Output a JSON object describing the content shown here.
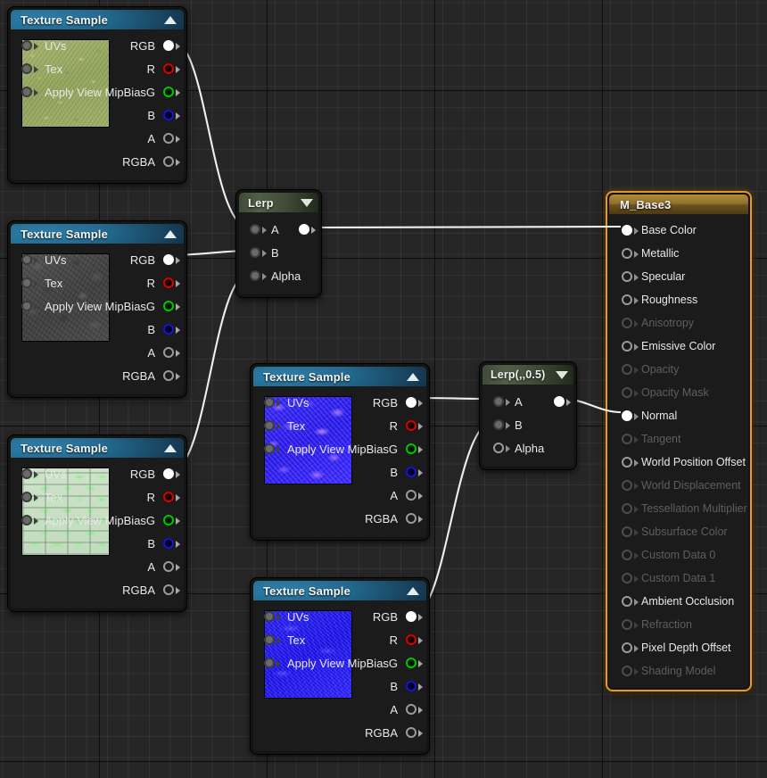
{
  "editor": {
    "name": "material-graph-editor",
    "background_color": "#262626",
    "grid_line_color": "#3a3a3a",
    "wire_color": "#ffffff"
  },
  "nodes": {
    "texture_grass": {
      "title": "Texture Sample",
      "header_color": "#23688f",
      "collapse_icon": "triangle-up-icon",
      "thumbnail": "grass-texture",
      "inputs": [
        {
          "label": "UVs",
          "connected": false
        },
        {
          "label": "Tex",
          "connected": false
        },
        {
          "label": "Apply View MipBias",
          "connected": false
        }
      ],
      "outputs": [
        {
          "label": "RGB",
          "type": "white",
          "connected": true
        },
        {
          "label": "R",
          "type": "red",
          "connected": false
        },
        {
          "label": "G",
          "type": "green",
          "connected": false
        },
        {
          "label": "B",
          "type": "blue",
          "connected": false
        },
        {
          "label": "A",
          "type": "grey",
          "connected": false
        },
        {
          "label": "RGBA",
          "type": "grey",
          "connected": false
        }
      ]
    },
    "texture_rock": {
      "title": "Texture Sample",
      "header_color": "#23688f",
      "collapse_icon": "triangle-up-icon",
      "thumbnail": "rock-texture",
      "inputs": [
        {
          "label": "UVs",
          "connected": false
        },
        {
          "label": "Tex",
          "connected": false
        },
        {
          "label": "Apply View MipBias",
          "connected": false
        }
      ],
      "outputs": [
        {
          "label": "RGB",
          "type": "white",
          "connected": true
        },
        {
          "label": "R",
          "type": "red",
          "connected": false
        },
        {
          "label": "G",
          "type": "green",
          "connected": false
        },
        {
          "label": "B",
          "type": "blue",
          "connected": false
        },
        {
          "label": "A",
          "type": "grey",
          "connected": false
        },
        {
          "label": "RGBA",
          "type": "grey",
          "connected": false
        }
      ]
    },
    "texture_mint": {
      "title": "Texture Sample",
      "header_color": "#23688f",
      "collapse_icon": "triangle-up-icon",
      "thumbnail": "mint-brick-texture",
      "inputs": [
        {
          "label": "UVs",
          "connected": false
        },
        {
          "label": "Tex",
          "connected": false
        },
        {
          "label": "Apply View MipBias",
          "connected": false
        }
      ],
      "outputs": [
        {
          "label": "RGB",
          "type": "white",
          "connected": true
        },
        {
          "label": "R",
          "type": "red",
          "connected": false
        },
        {
          "label": "G",
          "type": "green",
          "connected": false
        },
        {
          "label": "B",
          "type": "blue",
          "connected": false
        },
        {
          "label": "A",
          "type": "grey",
          "connected": false
        },
        {
          "label": "RGBA",
          "type": "grey",
          "connected": false
        }
      ]
    },
    "texture_normal_rough": {
      "title": "Texture Sample",
      "header_color": "#23688f",
      "collapse_icon": "triangle-up-icon",
      "thumbnail": "normal-map-rough-texture",
      "inputs": [
        {
          "label": "UVs",
          "connected": false
        },
        {
          "label": "Tex",
          "connected": false
        },
        {
          "label": "Apply View MipBias",
          "connected": false
        }
      ],
      "outputs": [
        {
          "label": "RGB",
          "type": "white",
          "connected": true
        },
        {
          "label": "R",
          "type": "red",
          "connected": false
        },
        {
          "label": "G",
          "type": "green",
          "connected": false
        },
        {
          "label": "B",
          "type": "blue",
          "connected": false
        },
        {
          "label": "A",
          "type": "grey",
          "connected": false
        },
        {
          "label": "RGBA",
          "type": "grey",
          "connected": false
        }
      ]
    },
    "texture_normal_flat": {
      "title": "Texture Sample",
      "header_color": "#23688f",
      "collapse_icon": "triangle-up-icon",
      "thumbnail": "normal-map-flat-texture",
      "inputs": [
        {
          "label": "UVs",
          "connected": false
        },
        {
          "label": "Tex",
          "connected": false
        },
        {
          "label": "Apply View MipBias",
          "connected": false
        }
      ],
      "outputs": [
        {
          "label": "RGB",
          "type": "white",
          "connected": true
        },
        {
          "label": "R",
          "type": "red",
          "connected": false
        },
        {
          "label": "G",
          "type": "green",
          "connected": false
        },
        {
          "label": "B",
          "type": "blue",
          "connected": false
        },
        {
          "label": "A",
          "type": "grey",
          "connected": false
        },
        {
          "label": "RGBA",
          "type": "grey",
          "connected": false
        }
      ]
    },
    "lerp_base": {
      "title": "Lerp",
      "header_color": "#4c5a42",
      "collapse_icon": "triangle-down-icon",
      "inputs": [
        {
          "label": "A",
          "connected": true
        },
        {
          "label": "B",
          "connected": true
        },
        {
          "label": "Alpha",
          "connected": true
        }
      ],
      "output": {
        "connected": true
      }
    },
    "lerp_normal": {
      "title": "Lerp(,,0.5)",
      "header_color": "#4c5a42",
      "collapse_icon": "triangle-down-icon",
      "inputs": [
        {
          "label": "A",
          "connected": true
        },
        {
          "label": "B",
          "connected": true
        },
        {
          "label": "Alpha",
          "connected": false
        }
      ],
      "output": {
        "connected": true
      }
    },
    "material_output": {
      "title": "M_Base3",
      "header_color": "#8e6f2b",
      "border_color": "#e79a1c",
      "selected": true,
      "pins": [
        {
          "label": "Base Color",
          "enabled": true,
          "connected": true
        },
        {
          "label": "Metallic",
          "enabled": true,
          "connected": false
        },
        {
          "label": "Specular",
          "enabled": true,
          "connected": false
        },
        {
          "label": "Roughness",
          "enabled": true,
          "connected": false
        },
        {
          "label": "Anisotropy",
          "enabled": false,
          "connected": false
        },
        {
          "label": "Emissive Color",
          "enabled": true,
          "connected": false
        },
        {
          "label": "Opacity",
          "enabled": false,
          "connected": false
        },
        {
          "label": "Opacity Mask",
          "enabled": false,
          "connected": false
        },
        {
          "label": "Normal",
          "enabled": true,
          "connected": true
        },
        {
          "label": "Tangent",
          "enabled": false,
          "connected": false
        },
        {
          "label": "World Position Offset",
          "enabled": true,
          "connected": false
        },
        {
          "label": "World Displacement",
          "enabled": false,
          "connected": false
        },
        {
          "label": "Tessellation Multiplier",
          "enabled": false,
          "connected": false
        },
        {
          "label": "Subsurface Color",
          "enabled": false,
          "connected": false
        },
        {
          "label": "Custom Data 0",
          "enabled": false,
          "connected": false
        },
        {
          "label": "Custom Data 1",
          "enabled": false,
          "connected": false
        },
        {
          "label": "Ambient Occlusion",
          "enabled": true,
          "connected": false
        },
        {
          "label": "Refraction",
          "enabled": false,
          "connected": false
        },
        {
          "label": "Pixel Depth Offset",
          "enabled": true,
          "connected": false
        },
        {
          "label": "Shading Model",
          "enabled": false,
          "connected": false
        }
      ]
    }
  },
  "connections": [
    {
      "from": "texture_grass.RGB",
      "to": "lerp_base.A"
    },
    {
      "from": "texture_rock.RGB",
      "to": "lerp_base.B"
    },
    {
      "from": "texture_mint.RGB",
      "to": "lerp_base.Alpha"
    },
    {
      "from": "lerp_base.out",
      "to": "material_output.Base Color"
    },
    {
      "from": "texture_normal_rough.RGB",
      "to": "lerp_normal.A"
    },
    {
      "from": "texture_normal_flat.RGB",
      "to": "lerp_normal.B"
    },
    {
      "from": "lerp_normal.out",
      "to": "material_output.Normal"
    }
  ]
}
